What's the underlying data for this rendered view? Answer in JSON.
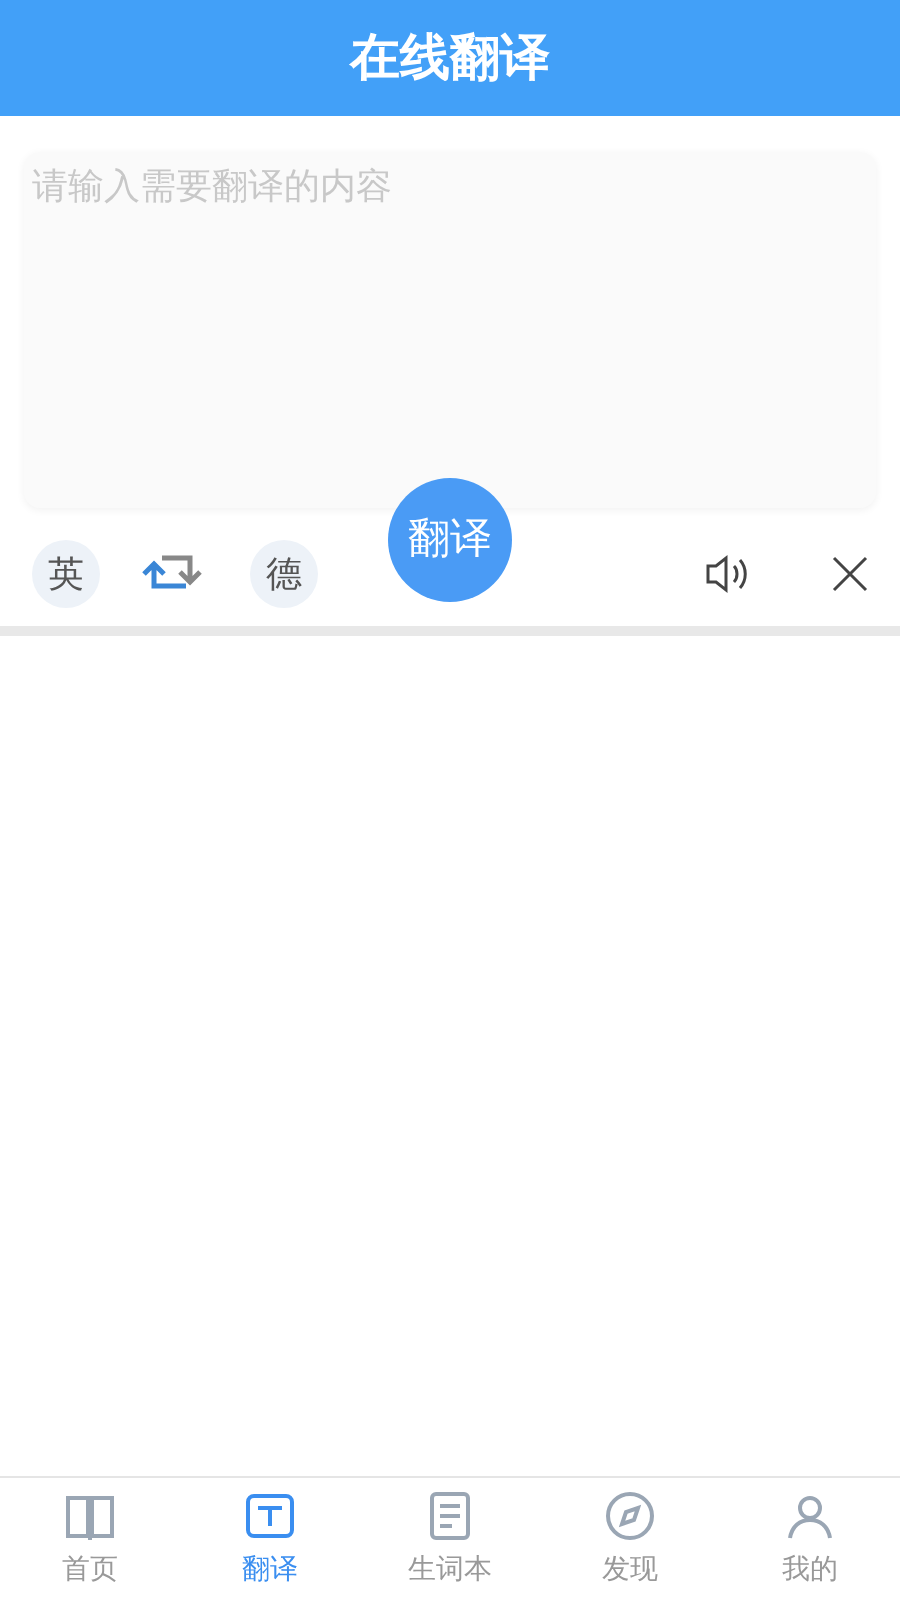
{
  "header": {
    "title": "在线翻译"
  },
  "input": {
    "placeholder": "请输入需要翻译的内容"
  },
  "toolbar": {
    "source_language": "英",
    "target_language": "德",
    "translate_button": "翻译"
  },
  "tabs": [
    {
      "label": "首页",
      "selected": false
    },
    {
      "label": "翻译",
      "selected": true
    },
    {
      "label": "生词本",
      "selected": false
    },
    {
      "label": "发现",
      "selected": false
    },
    {
      "label": "我的",
      "selected": false
    }
  ]
}
